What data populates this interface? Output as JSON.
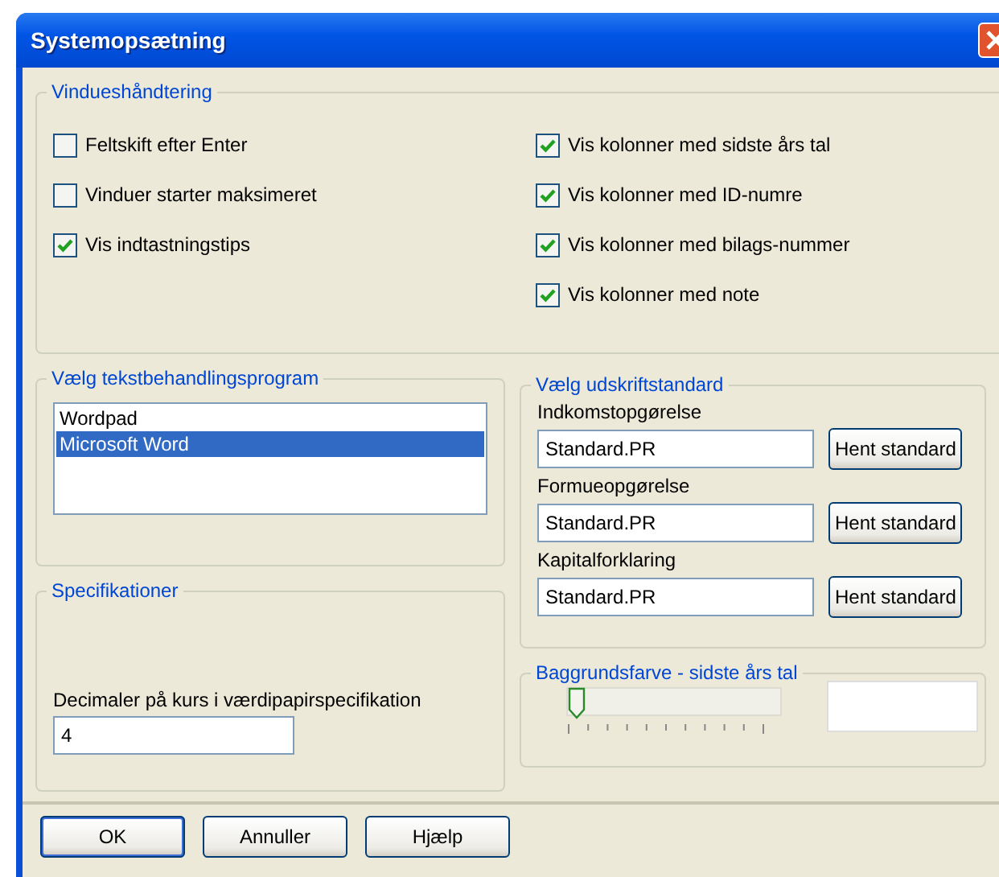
{
  "window": {
    "title": "Systemopsætning"
  },
  "window_handling": {
    "title": "Vindueshåndtering",
    "left": [
      {
        "label": "Feltskift efter Enter",
        "checked": false
      },
      {
        "label": "Vinduer starter maksimeret",
        "checked": false
      },
      {
        "label": "Vis indtastningstips",
        "checked": true
      }
    ],
    "right": [
      {
        "label": "Vis kolonner med sidste års tal",
        "checked": true
      },
      {
        "label": "Vis kolonner med ID-numre",
        "checked": true
      },
      {
        "label": "Vis kolonner med bilags-nummer",
        "checked": true
      },
      {
        "label": "Vis kolonner med note",
        "checked": true
      }
    ]
  },
  "word_processor": {
    "title": "Vælg tekstbehandlingsprogram",
    "items": [
      {
        "label": "Wordpad",
        "selected": false
      },
      {
        "label": "Microsoft Word",
        "selected": true
      }
    ]
  },
  "specifications": {
    "title": "Specifikationer",
    "field_label": "Decimaler på kurs i værdipapirspecifikation",
    "value": "4"
  },
  "print_standard": {
    "title": "Vælg udskriftstandard",
    "rows": [
      {
        "label": "Indkomstopgørelse",
        "value": "Standard.PR",
        "button": "Hent standard"
      },
      {
        "label": "Formueopgørelse",
        "value": "Standard.PR",
        "button": "Hent standard"
      },
      {
        "label": "Kapitalforklaring",
        "value": "Standard.PR",
        "button": "Hent standard"
      }
    ]
  },
  "background_color": {
    "title": "Baggrundsfarve - sidste års tal",
    "level": 0
  },
  "buttons": [
    {
      "label": "OK",
      "default": true
    },
    {
      "label": "Annuller",
      "default": false
    },
    {
      "label": "Hjælp",
      "default": false
    }
  ]
}
